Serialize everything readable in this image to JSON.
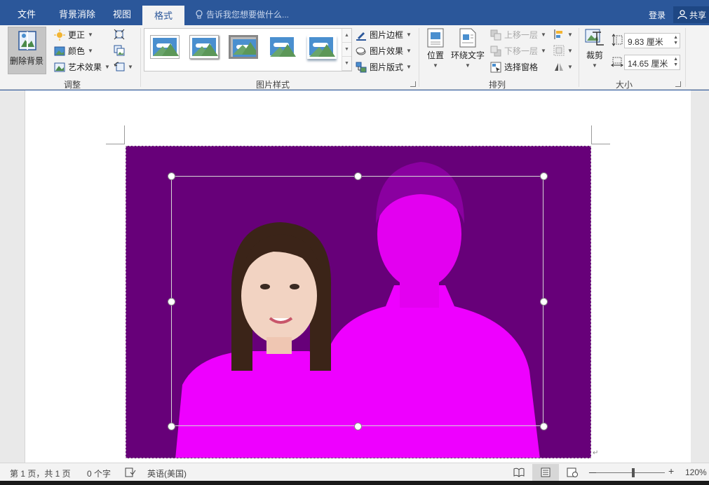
{
  "tabs": [
    {
      "label": "文件",
      "active": false
    },
    {
      "label": "背景消除",
      "active": false
    },
    {
      "label": "视图",
      "active": false
    },
    {
      "label": "格式",
      "active": true
    }
  ],
  "tell_me": {
    "placeholder": "告诉我您想要做什么..."
  },
  "account": {
    "login": "登录",
    "share": "共享"
  },
  "ribbon": {
    "adjust": {
      "label": "调整",
      "remove_background": "删除背景",
      "corrections": "更正",
      "color": "颜色",
      "artistic_effects": "艺术效果"
    },
    "picture_styles": {
      "label": "图片样式",
      "border": "图片边框",
      "effects": "图片效果",
      "layout": "图片版式"
    },
    "arrange": {
      "label": "排列",
      "position": "位置",
      "wrap_text": "环绕文字",
      "bring_forward": "上移一层",
      "send_backward": "下移一层",
      "selection_pane": "选择窗格"
    },
    "size": {
      "label": "大小",
      "crop": "裁剪",
      "height": "9.83 厘米",
      "width": "14.65 厘米"
    }
  },
  "statusbar": {
    "page": "第 1 页，共 1 页",
    "words": "0 个字",
    "language": "英语(美国)",
    "zoom": "120%",
    "zoom_minus": "－",
    "zoom_plus": "+"
  },
  "colors": {
    "title_bar": "#2b579a",
    "removed_area": "#670079",
    "kept_foreground_tint": "#ee00ff"
  }
}
